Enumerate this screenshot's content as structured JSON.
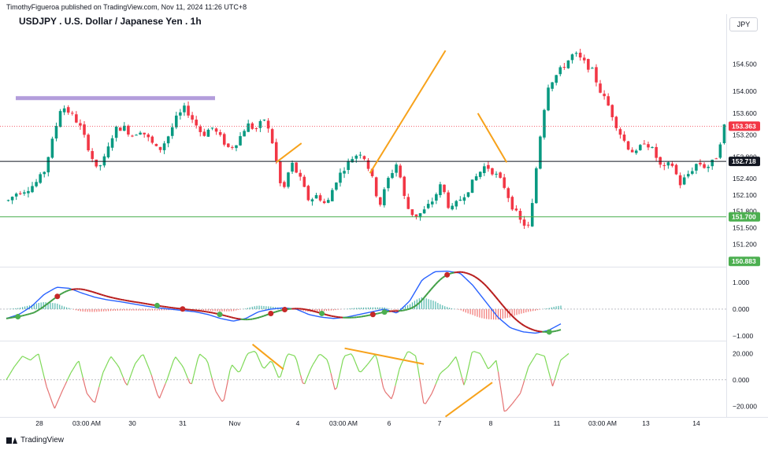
{
  "header": {
    "published": "TimothyFigueroa published on TradingView.com, Nov 11, 2024 11:26 UTC+8",
    "title": "USDJPY . U.S. Dollar / Japanese Yen . 1h",
    "symbol_badge": "JPY"
  },
  "footer": {
    "brand": "TradingView"
  },
  "colors": {
    "up": "#089981",
    "down": "#f23645",
    "grid": "#f0f3fa",
    "support_green": "#4caf50",
    "black_line": "#131722",
    "resistance_band": "#b39ddb",
    "trend_orange": "#f7a21b",
    "macd_line": "#2962ff",
    "signal_green": "#43a047",
    "signal_red": "#b71c1c",
    "rsi_green": "#7ed957",
    "rsi_red": "#e57373"
  },
  "chart_data": [
    {
      "type": "candlestick",
      "name": "price",
      "y_ticks": [
        "154.500",
        "154.000",
        "153.600",
        "153.200",
        "152.800",
        "152.400",
        "152.100",
        "151.800",
        "151.500",
        "151.200"
      ],
      "ylim": [
        150.8,
        155.1
      ],
      "x_ticks": [
        "28",
        "03:00 AM",
        "30",
        "31",
        "Nov",
        "4",
        "03:00 AM",
        "6",
        "7",
        "8",
        "11",
        "03:00 AM",
        "13",
        "14"
      ],
      "close_path": [
        152.0,
        152.15,
        152.2,
        152.3,
        152.5,
        153.1,
        153.75,
        153.6,
        153.4,
        153.0,
        152.55,
        152.8,
        153.3,
        153.35,
        153.2,
        153.3,
        153.1,
        152.9,
        153.15,
        153.5,
        153.7,
        153.45,
        153.2,
        153.35,
        153.15,
        152.95,
        153.1,
        153.4,
        153.3,
        153.5,
        153.0,
        152.1,
        152.7,
        152.4,
        152.0,
        152.1,
        151.9,
        152.35,
        152.6,
        152.8,
        152.9,
        152.5,
        151.9,
        152.4,
        152.7,
        151.9,
        151.7,
        151.8,
        152.0,
        152.3,
        151.8,
        152.0,
        152.2,
        152.45,
        152.65,
        152.5,
        152.3,
        151.9,
        151.6,
        151.5,
        153.0,
        154.1,
        154.3,
        154.5,
        154.7,
        154.55,
        154.4,
        154.0,
        153.7,
        153.3,
        153.0,
        152.85,
        153.1,
        152.9,
        152.55,
        152.7,
        152.3,
        152.5,
        152.7,
        152.6,
        152.75,
        153.363
      ],
      "levels": [
        {
          "value": 153.363,
          "label": "153.363",
          "style": "dotted-red"
        },
        {
          "value": 152.718,
          "label": "152.718",
          "style": "black"
        },
        {
          "value": 151.7,
          "label": "151.700",
          "style": "green"
        },
        {
          "value": 150.883,
          "label": "150.883",
          "style": "badge-only"
        }
      ],
      "resistance_band": 153.87,
      "trendlines": [
        {
          "x": [
            0.375,
            0.41
          ],
          "y": [
            152.7,
            153.05
          ]
        },
        {
          "x": [
            0.505,
            0.61
          ],
          "y": [
            152.5,
            154.75
          ]
        },
        {
          "x": [
            0.655,
            0.695
          ],
          "y": [
            153.6,
            152.7
          ]
        }
      ]
    },
    {
      "type": "line",
      "name": "macd",
      "y_ticks": [
        "1.000",
        "0.000",
        "−1.000"
      ],
      "ylim": [
        -1.15,
        1.5
      ],
      "macd_path": [
        -0.35,
        -0.2,
        0.1,
        0.55,
        0.82,
        0.78,
        0.6,
        0.45,
        0.35,
        0.28,
        0.2,
        0.12,
        0.05,
        0.0,
        -0.05,
        -0.1,
        -0.2,
        -0.35,
        -0.45,
        -0.35,
        -0.1,
        0.0,
        0.05,
        0.0,
        -0.2,
        -0.3,
        -0.35,
        -0.3,
        -0.2,
        -0.1,
        0.0,
        -0.15,
        0.3,
        1.1,
        1.4,
        1.42,
        1.35,
        0.9,
        0.3,
        -0.3,
        -0.7,
        -0.85,
        -0.9,
        -0.8,
        -0.55
      ],
      "dots": [
        {
          "i": 1,
          "color": "green"
        },
        {
          "i": 4,
          "color": "red"
        },
        {
          "i": 12,
          "color": "green"
        },
        {
          "i": 14,
          "color": "red"
        },
        {
          "i": 17,
          "color": "green"
        },
        {
          "i": 21,
          "color": "red"
        },
        {
          "i": 22,
          "color": "red"
        },
        {
          "i": 25,
          "color": "green"
        },
        {
          "i": 29,
          "color": "red"
        },
        {
          "i": 30,
          "color": "green"
        },
        {
          "i": 35,
          "color": "red"
        },
        {
          "i": 43,
          "color": "green"
        }
      ]
    },
    {
      "type": "line",
      "name": "oscillator",
      "y_ticks": [
        "20.000",
        "0.000",
        "−20.000"
      ],
      "ylim": [
        -27,
        28
      ],
      "osc_path": [
        0,
        10,
        18,
        15,
        20,
        -5,
        -22,
        -8,
        5,
        15,
        -10,
        -18,
        5,
        18,
        10,
        -5,
        12,
        20,
        5,
        -15,
        0,
        18,
        10,
        -5,
        20,
        15,
        -8,
        -18,
        12,
        5,
        20,
        22,
        8,
        15,
        0,
        20,
        18,
        -5,
        10,
        20,
        15,
        -10,
        18,
        20,
        5,
        12,
        20,
        -8,
        -15,
        10,
        22,
        18,
        -20,
        -10,
        5,
        10,
        18,
        -5,
        22,
        20,
        8,
        15,
        -25,
        -18,
        -10,
        10,
        20,
        18,
        -5,
        15,
        20
      ],
      "trendlines": [
        {
          "x": [
            0.342,
            0.385
          ],
          "y": [
            27,
            8
          ]
        },
        {
          "x": [
            0.47,
            0.58
          ],
          "y": [
            24,
            12
          ]
        },
        {
          "x": [
            0.61,
            0.675
          ],
          "y": [
            -28,
            -2
          ]
        }
      ]
    }
  ]
}
